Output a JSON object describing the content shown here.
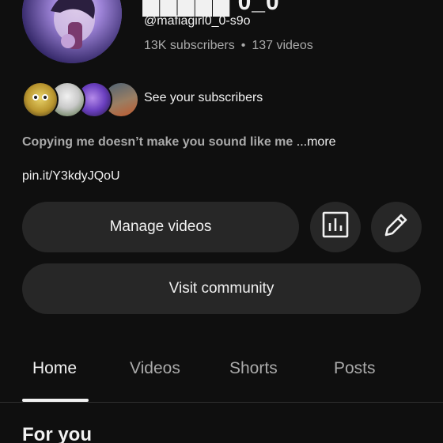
{
  "channel": {
    "name": "█████ 0_0",
    "handle": "@mafiagirl0_0-s9o",
    "subscribers": "13K subscribers",
    "separator": "•",
    "videos": "137 videos"
  },
  "subscribers_row": {
    "label": "See your subscribers"
  },
  "description": {
    "text": "Copying me doesn’t make you sound like me ",
    "more": "...more"
  },
  "link": "pin.it/Y3kdyJQoU",
  "buttons": {
    "manage_videos": "Manage videos",
    "visit_community": "Visit community"
  },
  "tabs": [
    {
      "label": "Home",
      "active": true
    },
    {
      "label": "Videos",
      "active": false
    },
    {
      "label": "Shorts",
      "active": false
    },
    {
      "label": "Posts",
      "active": false
    }
  ],
  "section": {
    "title": "For you"
  },
  "colors": {
    "background": "#0f0f0f",
    "button": "#272727",
    "text_primary": "#f1f1f1",
    "text_secondary": "#aaaaaa"
  },
  "icons": {
    "analytics": "bar-chart-icon",
    "edit": "pencil-icon"
  }
}
